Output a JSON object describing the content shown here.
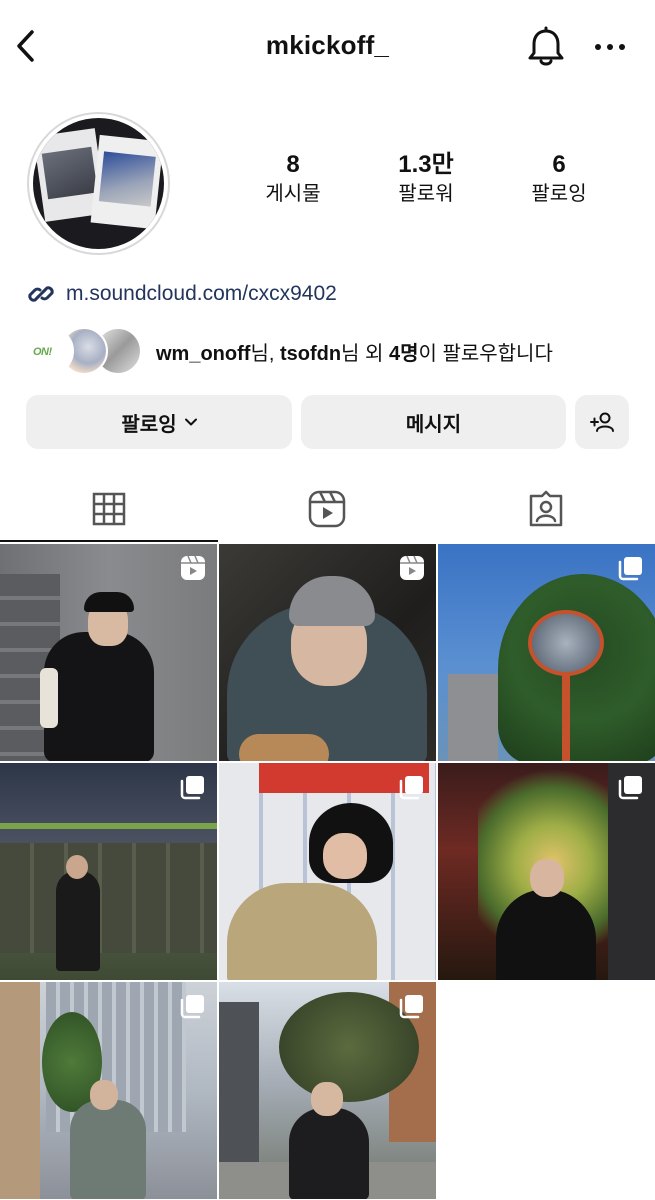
{
  "header": {
    "username": "mkickoff_",
    "back_icon": "chevron-left-icon",
    "notification_icon": "bell-icon",
    "more_icon": "more-horizontal-icon"
  },
  "stats": [
    {
      "value": "8",
      "label": "게시물"
    },
    {
      "value": "1.3만",
      "label": "팔로워"
    },
    {
      "value": "6",
      "label": "팔로잉"
    }
  ],
  "bio": {
    "link": "m.soundcloud.com/cxcx9402",
    "link_icon": "link-icon"
  },
  "mutual_followers": {
    "user1": "wm_onoff",
    "sep1": "님, ",
    "user2": "tsofdn",
    "sep2": "님 외 ",
    "count": "4명",
    "suffix": "이 팔로우합니다",
    "avatar1_logo": "ON!"
  },
  "actions": {
    "following_label": "팔로잉",
    "message_label": "메시지",
    "add_user_icon": "add-user-icon"
  },
  "tabs": [
    {
      "icon": "grid-icon",
      "active": true
    },
    {
      "icon": "reels-icon",
      "active": false
    },
    {
      "icon": "tagged-icon",
      "active": false
    }
  ],
  "posts": [
    {
      "type": "reel"
    },
    {
      "type": "reel"
    },
    {
      "type": "carousel"
    },
    {
      "type": "carousel"
    },
    {
      "type": "carousel"
    },
    {
      "type": "carousel"
    },
    {
      "type": "carousel"
    },
    {
      "type": "carousel"
    }
  ],
  "colors": {
    "link": "#23355c",
    "button_bg": "#efefef",
    "text": "#111111"
  }
}
